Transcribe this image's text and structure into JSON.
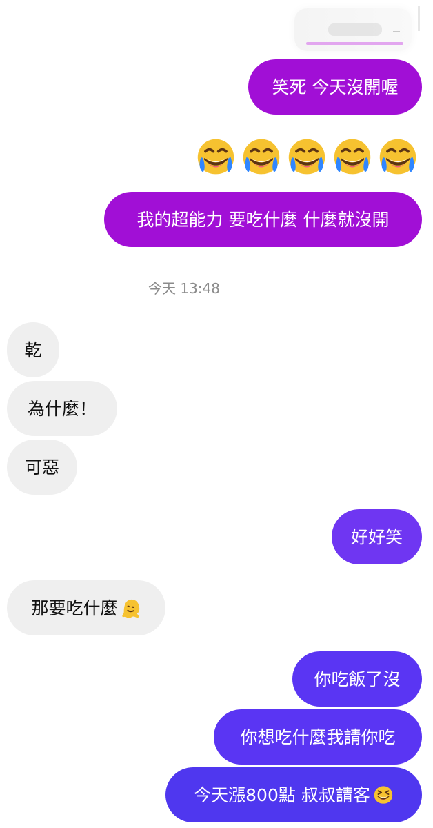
{
  "messages": {
    "m1": "笑死 今天沒開喔",
    "m2": "我的超能力 要吃什麼 什麼就沒開",
    "timestamp": "今天 13:48",
    "r1": "乾",
    "r2": "為什麼！",
    "r3": "可惡",
    "m3": "好好笑",
    "r4": "那要吃什麼",
    "m4": "你吃飯了沒",
    "m5": "你想吃什麼我請你吃",
    "m6": "今天漲800點 叔叔請客"
  },
  "icons": {
    "laugh": "face-with-tears-of-joy",
    "melting": "melting-face",
    "grin": "grinning-squinting-face"
  },
  "colors": {
    "outgoing_purple": "#a10fd6",
    "outgoing_violet": "#6f36f2",
    "incoming_gray": "#efefef",
    "timestamp_gray": "#8b8b8b"
  }
}
